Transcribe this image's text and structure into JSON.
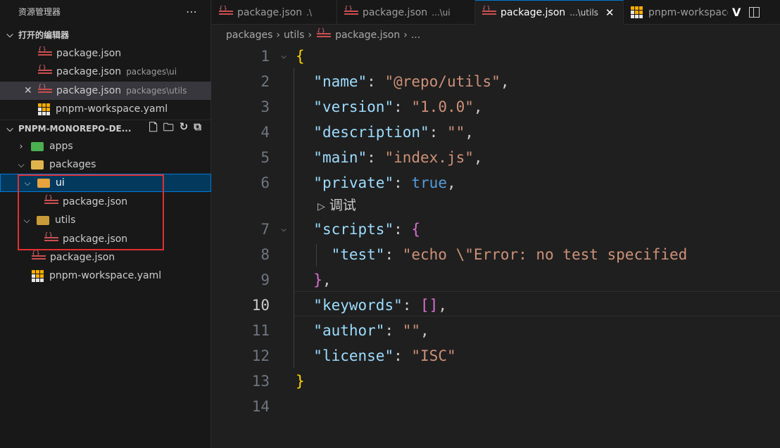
{
  "explorer": {
    "title": "资源管理器",
    "more_icon": "ellipsis-icon",
    "open_editors": {
      "label": "打开的编辑器",
      "items": [
        {
          "name": "package.json",
          "desc": ""
        },
        {
          "name": "package.json",
          "desc": "packages\\ui"
        },
        {
          "name": "package.json",
          "desc": "packages\\utils"
        },
        {
          "name": "pnpm-workspace.yaml",
          "desc": ""
        }
      ]
    },
    "workspace": {
      "label": "PNPM-MONOREPO-DE...",
      "actions": [
        "new-file-icon",
        "new-folder-icon",
        "refresh-icon",
        "collapse-all-icon"
      ],
      "tree": [
        {
          "name": "apps"
        },
        {
          "name": "packages"
        },
        {
          "name": "ui"
        },
        {
          "name": "package.json"
        },
        {
          "name": "utils"
        },
        {
          "name": "package.json"
        },
        {
          "name": "package.json"
        },
        {
          "name": "pnpm-workspace.yaml"
        }
      ]
    }
  },
  "tabs": [
    {
      "name": "package.json",
      "desc": ".\\"
    },
    {
      "name": "package.json",
      "desc": "...\\ui"
    },
    {
      "name": "package.json",
      "desc": "...\\utils"
    },
    {
      "name": "pnpm-workspace.yaml",
      "desc": ""
    }
  ],
  "tab_extra": "V",
  "breadcrumb": [
    "packages",
    "utils",
    "package.json",
    "..."
  ],
  "editor": {
    "line_numbers": [
      "1",
      "2",
      "3",
      "4",
      "5",
      "6",
      "7",
      "8",
      "9",
      "10",
      "11",
      "12",
      "13",
      "14"
    ],
    "current_line": "10",
    "codelens": "调试",
    "code": {
      "open_brace": "{",
      "close_brace": "}",
      "k_name": "\"name\"",
      "v_name": "\"@repo/utils\"",
      "k_version": "\"version\"",
      "v_version": "\"1.0.0\"",
      "k_description": "\"description\"",
      "v_description": "\"\"",
      "k_main": "\"main\"",
      "v_main": "\"index.js\"",
      "k_private": "\"private\"",
      "v_private": "true",
      "k_scripts": "\"scripts\"",
      "k_test": "\"test\"",
      "v_test": "\"echo \\\"Error: no test specified",
      "k_keywords": "\"keywords\"",
      "v_keywords": "[]",
      "k_author": "\"author\"",
      "v_author": "\"\"",
      "k_license": "\"license\"",
      "v_license": "\"ISC\""
    }
  },
  "colors": {
    "bg": "#1f1f1f",
    "sidebar_bg": "#181818",
    "selected_row": "#04395e",
    "selected_border": "#0078d4",
    "highlight_box": "#e03030",
    "json_key": "#9cdcfe",
    "json_string": "#ce9178",
    "brace_level1": "#ffd700",
    "brace_level2": "#da70d6",
    "keyword": "#569cd6"
  }
}
